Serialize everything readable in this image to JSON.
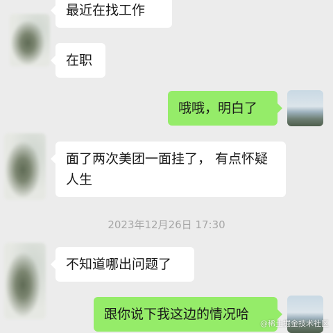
{
  "messages": [
    {
      "side": "left",
      "text": "最近在找工作"
    },
    {
      "side": "left",
      "text": "在职"
    },
    {
      "side": "right",
      "text": "哦哦，明白了"
    },
    {
      "side": "left",
      "text": "面了两次美团一面挂了， 有点怀疑人生"
    },
    {
      "side": "left",
      "text": "不知道哪出问题了"
    },
    {
      "side": "right",
      "text": "跟你说下我这边的情况哈"
    }
  ],
  "timestamp": "2023年12月26日 17:30",
  "watermark": "@稀土掘金技术社区"
}
